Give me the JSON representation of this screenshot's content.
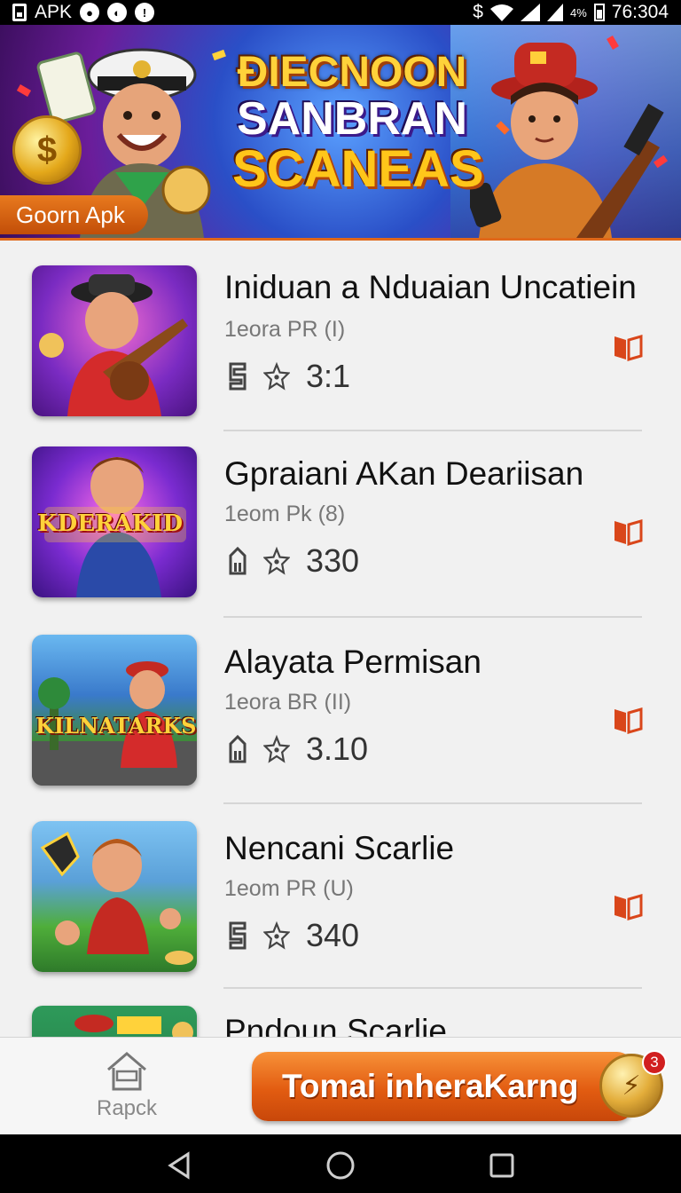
{
  "status_bar": {
    "left_text": "APK",
    "time": "76:304",
    "battery": "4%",
    "dollar": "$"
  },
  "banner": {
    "title_line1": "ÐIECNOON",
    "title_line2": "SANBRAN",
    "title_line3": "SCANEAS",
    "tag": "Goorn Apk"
  },
  "items": [
    {
      "title": "Iniduan a Nduaian Uncatiein",
      "subtitle": "1eora PR (I)",
      "rating": "3:1",
      "thumb_text": ""
    },
    {
      "title": "Gpraiani AKan Deariisan",
      "subtitle": "1eom Pk (8)",
      "rating": "330",
      "thumb_text": "KDERAKID"
    },
    {
      "title": "Alayata Permisan",
      "subtitle": "1eora BR (II)",
      "rating": "3.10",
      "thumb_text": "KILNATARKS"
    },
    {
      "title": "Nencani Scarlie",
      "subtitle": "1eom PR (U)",
      "rating": "340",
      "thumb_text": ""
    },
    {
      "title": "Pndoun Scarlie",
      "subtitle": "",
      "rating": "",
      "thumb_text": ""
    }
  ],
  "bottom_bar": {
    "home_label": "Rapck",
    "cta_label": "Tomai inheraKarng",
    "badge_count": "3"
  },
  "colors": {
    "accent": "#e25c11",
    "bookmark": "#d9461a",
    "badge": "#d11f1f"
  }
}
